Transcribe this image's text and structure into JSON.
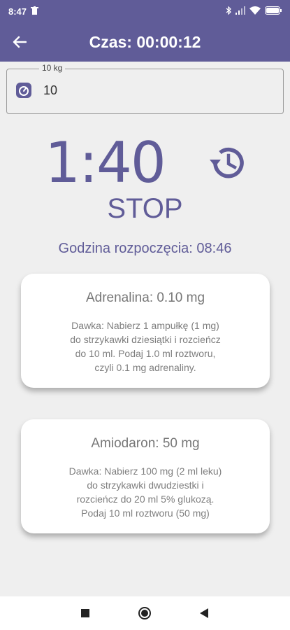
{
  "status_bar": {
    "time": "8:47"
  },
  "header": {
    "title": "Czas: 00:00:12"
  },
  "weight": {
    "label": "10 kg",
    "value": "10"
  },
  "timer": {
    "countdown": "1:40",
    "stop_label": "STOP"
  },
  "start_time": {
    "text": "Godzina rozpoczęcia: 08:46"
  },
  "cards": [
    {
      "title": "Adrenalina: 0.10 mg",
      "text": "Dawka: Nabierz 1 ampułkę (1 mg)\ndo strzykawki dziesiątki i rozcieńcz\ndo 10 ml. Podaj 1.0 ml roztworu,\nczyli 0.1 mg adrenaliny."
    },
    {
      "title": "Amiodaron: 50 mg",
      "text": "Dawka: Nabierz 100 mg (2 ml leku)\ndo strzykawki dwudziestki i\nrozcieńcz do 20 ml   5% glukozą.\nPodaj 10 ml roztworu (50 mg)"
    }
  ],
  "colors": {
    "primary": "#605c98",
    "background": "#efefef",
    "card": "#ffffff"
  },
  "icons": {
    "status_left": [
      "trash-icon"
    ],
    "status_right": [
      "bluetooth-icon",
      "signal-icon",
      "wifi-icon",
      "battery-icon"
    ],
    "header": "back-arrow-icon",
    "weight": "scale-icon",
    "history": "history-icon",
    "nav": [
      "square-icon",
      "circle-icon",
      "triangle-back-icon"
    ]
  }
}
